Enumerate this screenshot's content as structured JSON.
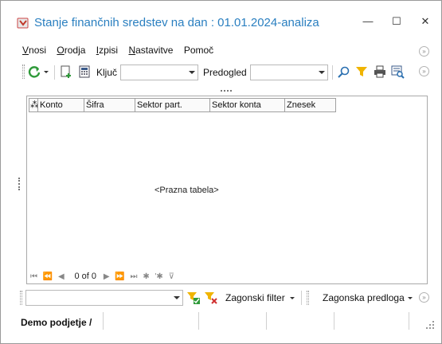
{
  "window": {
    "title": "Stanje finančnih sredstev na dan : 01.01.2024-analiza",
    "minimize": "—",
    "maximize": "☐",
    "close": "✕"
  },
  "menu": {
    "items": [
      {
        "accel": "V",
        "rest": "nosi"
      },
      {
        "accel": "O",
        "rest": "rodja"
      },
      {
        "accel": "I",
        "rest": "zpisi"
      },
      {
        "accel": "N",
        "rest": "astavitve"
      },
      {
        "accel": "",
        "rest": "Pomoč"
      }
    ]
  },
  "toolbar": {
    "kljuc_label": "Ključ",
    "kljuc_value": "",
    "predogled_label": "Predogled",
    "predogled_value": "",
    "icons": [
      "refresh-icon",
      "new-record-icon",
      "calculator-icon",
      "search-icon",
      "filter-icon",
      "print-icon",
      "preview-icon"
    ]
  },
  "grid": {
    "columns": [
      "Konto",
      "Šifra",
      "Sektor part.",
      "Sektor konta",
      "Znesek"
    ],
    "empty_message": "<Prazna tabela>",
    "pager": "0 of 0"
  },
  "filterbar": {
    "filter_value": "",
    "zagonski_filter": "Zagonski filter",
    "zagonska_predloga": "Zagonska predloga"
  },
  "status": {
    "company": "Demo podjetje /"
  },
  "colors": {
    "title": "#2a7fc0",
    "refresh": "#2f9a3a",
    "filter": "#f0b400"
  }
}
